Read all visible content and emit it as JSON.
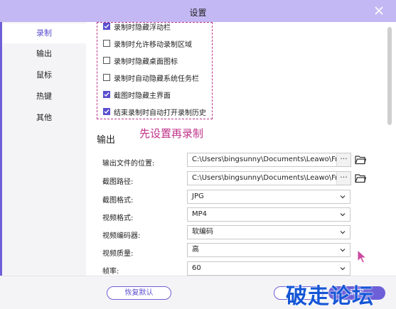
{
  "window": {
    "title": "设置"
  },
  "sidebar": {
    "items": [
      {
        "label": "录制",
        "active": true
      },
      {
        "label": "输出",
        "active": false
      },
      {
        "label": "鼠标",
        "active": false
      },
      {
        "label": "热键",
        "active": false
      },
      {
        "label": "其他",
        "active": false
      }
    ]
  },
  "recording_options": [
    {
      "label": "录制时隐藏浮动栏",
      "checked": true
    },
    {
      "label": "录制时允许移动录制区域",
      "checked": false
    },
    {
      "label": "录制时隐藏桌面图标",
      "checked": false
    },
    {
      "label": "录制时自动隐藏系统任务栏",
      "checked": false
    },
    {
      "label": "截图时隐藏主界面",
      "checked": true
    },
    {
      "label": "结束录制时自动打开录制历史",
      "checked": true
    }
  ],
  "annotation": "先设置再录制",
  "output": {
    "section_title": "输出",
    "file_location_label": "输出文件的位置:",
    "file_location_value": "C:\\Users\\bingsunny\\Documents\\Leawo\\Free S",
    "screenshot_path_label": "截图路径:",
    "screenshot_path_value": "C:\\Users\\bingsunny\\Documents\\Leawo\\Free S",
    "more_button": "···",
    "screenshot_format_label": "截图格式:",
    "screenshot_format_value": "JPG",
    "video_format_label": "视频格式:",
    "video_format_value": "MP4",
    "video_encoder_label": "视频编码器:",
    "video_encoder_value": "软编码",
    "video_quality_label": "视频质量:",
    "video_quality_value": "高",
    "frame_rate_label": "帧率:",
    "frame_rate_value": "60"
  },
  "footer": {
    "reset_label": "恢复默认",
    "cancel_label": "",
    "ok_label": "确定"
  },
  "watermark": "破走论坛",
  "colors": {
    "accent": "#6d5fd8",
    "titlebar": "#c4b8f4",
    "annotation": "#c0338a",
    "watermark": "#1556d6"
  },
  "icons": [
    "close-icon",
    "checkmark-icon",
    "folder-icon",
    "chevron-down-icon",
    "cursor-icon"
  ]
}
